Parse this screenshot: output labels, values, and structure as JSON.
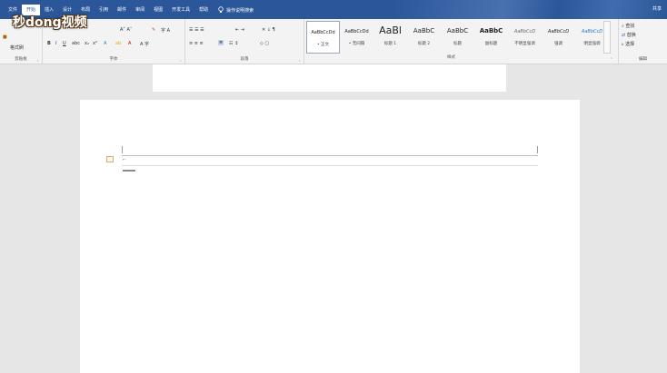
{
  "watermark": {
    "text": "秒dong视频"
  },
  "tabs": [
    "文件",
    "开始",
    "插入",
    "设计",
    "布局",
    "引用",
    "邮件",
    "审阅",
    "视图",
    "开发工具",
    "帮助"
  ],
  "active_tab_index": 1,
  "tell_me": "操作说明搜索",
  "share": "共享",
  "ribbon": {
    "clipboard": {
      "label": "剪贴板",
      "paste": "粘贴",
      "format_painter": "格式刷"
    },
    "font": {
      "label": "字体"
    },
    "paragraph": {
      "label": "段落"
    },
    "styles": {
      "label": "样式",
      "items": [
        {
          "preview": "AaBbCcDd",
          "name": "• 正文"
        },
        {
          "preview": "AaBbCcDd",
          "name": "• 无间隔"
        },
        {
          "preview": "AaBl",
          "name": "标题 1"
        },
        {
          "preview": "AaBbC",
          "name": "标题 2"
        },
        {
          "preview": "AaBbC",
          "name": "标题"
        },
        {
          "preview": "AaBbC",
          "name": "副标题"
        },
        {
          "preview": "AaBbCcD",
          "name": "不明显强调"
        },
        {
          "preview": "AaBbCcD",
          "name": "强调"
        },
        {
          "preview": "AaBbCcD",
          "name": "明显强调"
        }
      ]
    },
    "editing": {
      "label": "编辑",
      "find": "查找",
      "replace": "替换",
      "select": "选择"
    }
  },
  "colors": {
    "titlebar": "#2b579a",
    "ribbon_bg": "#f3f3f3",
    "doc_bg": "#e6e6e6"
  }
}
